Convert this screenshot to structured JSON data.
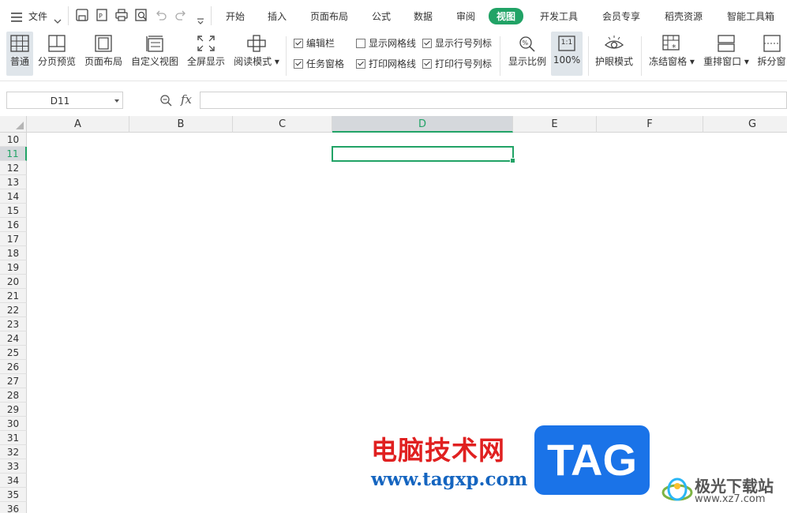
{
  "menubar": {
    "file_label": "文件",
    "tabs": [
      "开始",
      "插入",
      "页面布局",
      "公式",
      "数据",
      "审阅",
      "视图",
      "开发工具",
      "会员专享",
      "稻壳资源",
      "智能工具箱"
    ]
  },
  "ribbon": {
    "buttons": [
      "普通",
      "分页预览",
      "页面布局",
      "自定义视图",
      "全屏显示",
      "阅读模式"
    ],
    "checkboxes": [
      {
        "label": "编辑栏",
        "checked": true
      },
      {
        "label": "任务窗格",
        "checked": true
      },
      {
        "label": "显示网格线",
        "checked": false
      },
      {
        "label": "打印网格线",
        "checked": true
      },
      {
        "label": "显示行号列标",
        "checked": true
      },
      {
        "label": "打印行号列标",
        "checked": true
      }
    ],
    "zoom_buttons": [
      "显示比例",
      "100%"
    ],
    "zoom_icon_text": "1:1",
    "right_buttons": [
      "护眼模式",
      "冻结窗格",
      "重排窗口",
      "拆分窗"
    ]
  },
  "formulabar": {
    "name_box": "D11",
    "fx": "fx"
  },
  "sheet": {
    "columns": [
      "A",
      "B",
      "C",
      "D",
      "E",
      "F",
      "G"
    ],
    "selected_column": "D",
    "rows": [
      "10",
      "11",
      "12",
      "13",
      "14",
      "15",
      "16",
      "17",
      "18",
      "19",
      "20",
      "21",
      "22",
      "23",
      "24",
      "25",
      "26",
      "27",
      "28",
      "29",
      "30",
      "31",
      "32",
      "33",
      "34",
      "35",
      "36"
    ],
    "selected_row": "11",
    "selected_cell": "D11"
  },
  "watermark": {
    "cn_text": "电脑技术网",
    "url": "www.tagxp.com",
    "tag": "TAG",
    "site_name": "极光下载站",
    "site_url": "www.xz7.com"
  },
  "colors": {
    "accent": "#21a366",
    "watermark_red": "#e02020",
    "watermark_blue": "#1a73e8"
  }
}
